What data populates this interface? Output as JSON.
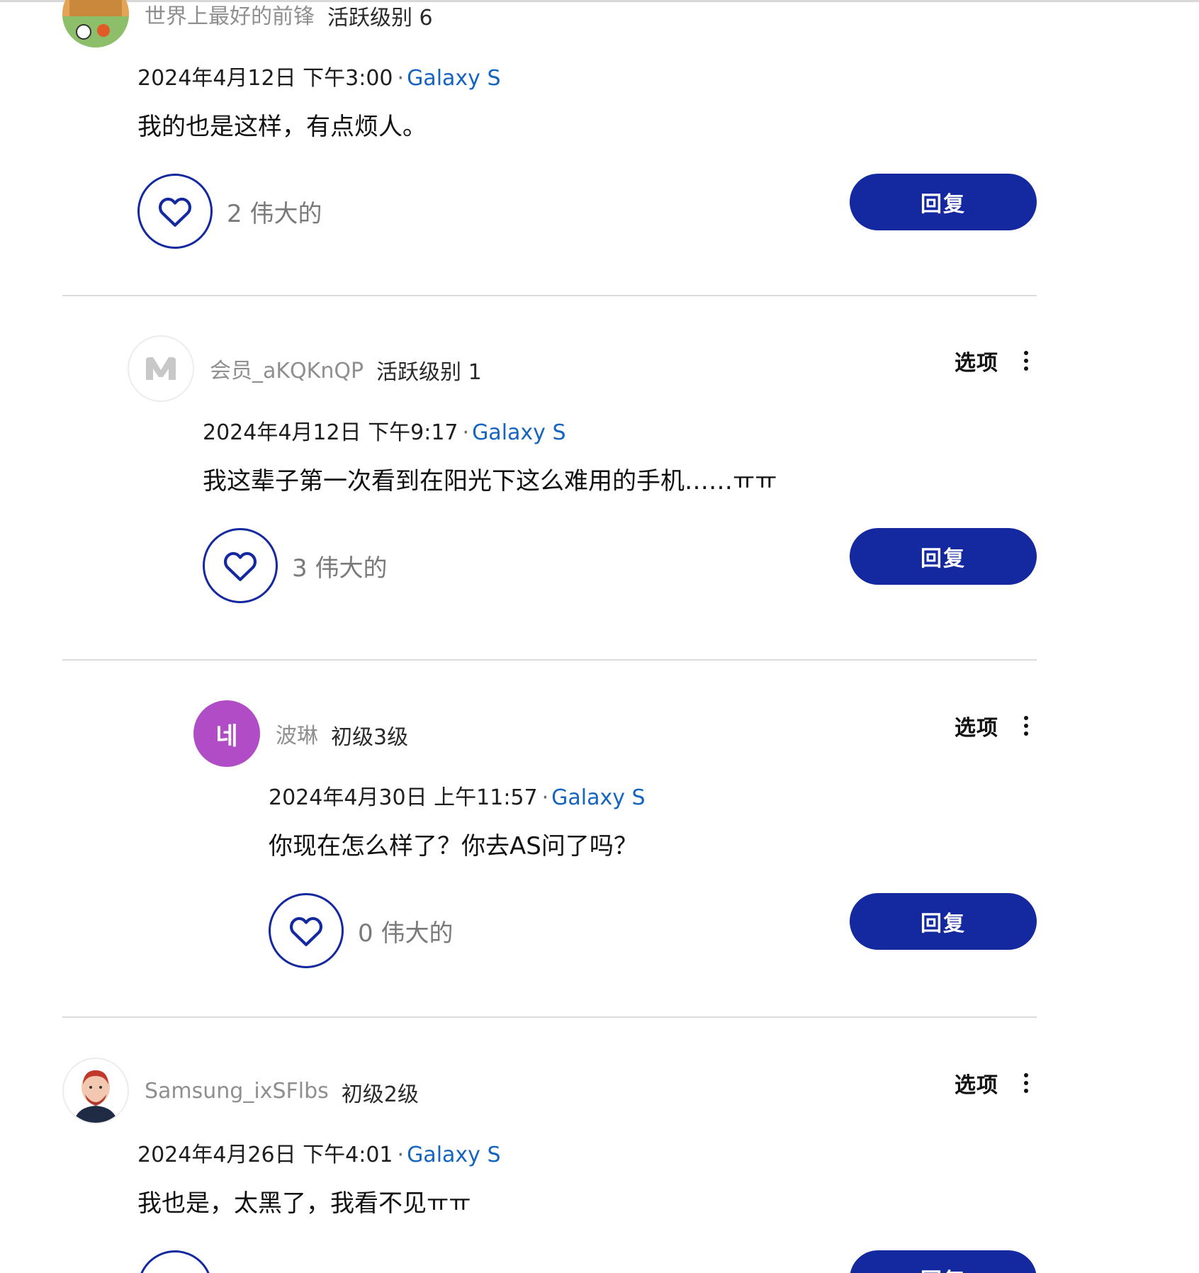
{
  "options_label": "选项",
  "reply_label": "回复",
  "posts": [
    {
      "author": "世界上最好的前锋",
      "rank": "活跃级别 6",
      "date": "2024年4月12日 下午3:00",
      "separator": "·",
      "device": "Galaxy S",
      "body": "我的也是这样，有点烦人。",
      "likes": "2 伟大的"
    },
    {
      "author": "会员_aKQKnQP",
      "rank": "活跃级别 1",
      "date": "2024年4月12日 下午9:17",
      "separator": "·",
      "device": "Galaxy S",
      "body": "我这辈子第一次看到在阳光下这么难用的手机……ㅠㅠ",
      "likes": "3 伟大的"
    },
    {
      "author": "波琳",
      "avatar_text": "네",
      "rank": "初级3级",
      "date": "2024年4月30日 上午11:57",
      "separator": "·",
      "device": "Galaxy S",
      "body": "你现在怎么样了？你去AS问了吗？",
      "likes": "0 伟大的"
    },
    {
      "author": "Samsung_ixSFlbs",
      "rank": "初级2级",
      "date": "2024年4月26日 下午4:01",
      "separator": "·",
      "device": "Galaxy S",
      "body": "我也是，太黑了，我看不见ㅠㅠ"
    }
  ],
  "colors": {
    "brand_blue": "#1428a0",
    "link_blue": "#1565c0",
    "avatar_purple": "#b04cc6"
  }
}
